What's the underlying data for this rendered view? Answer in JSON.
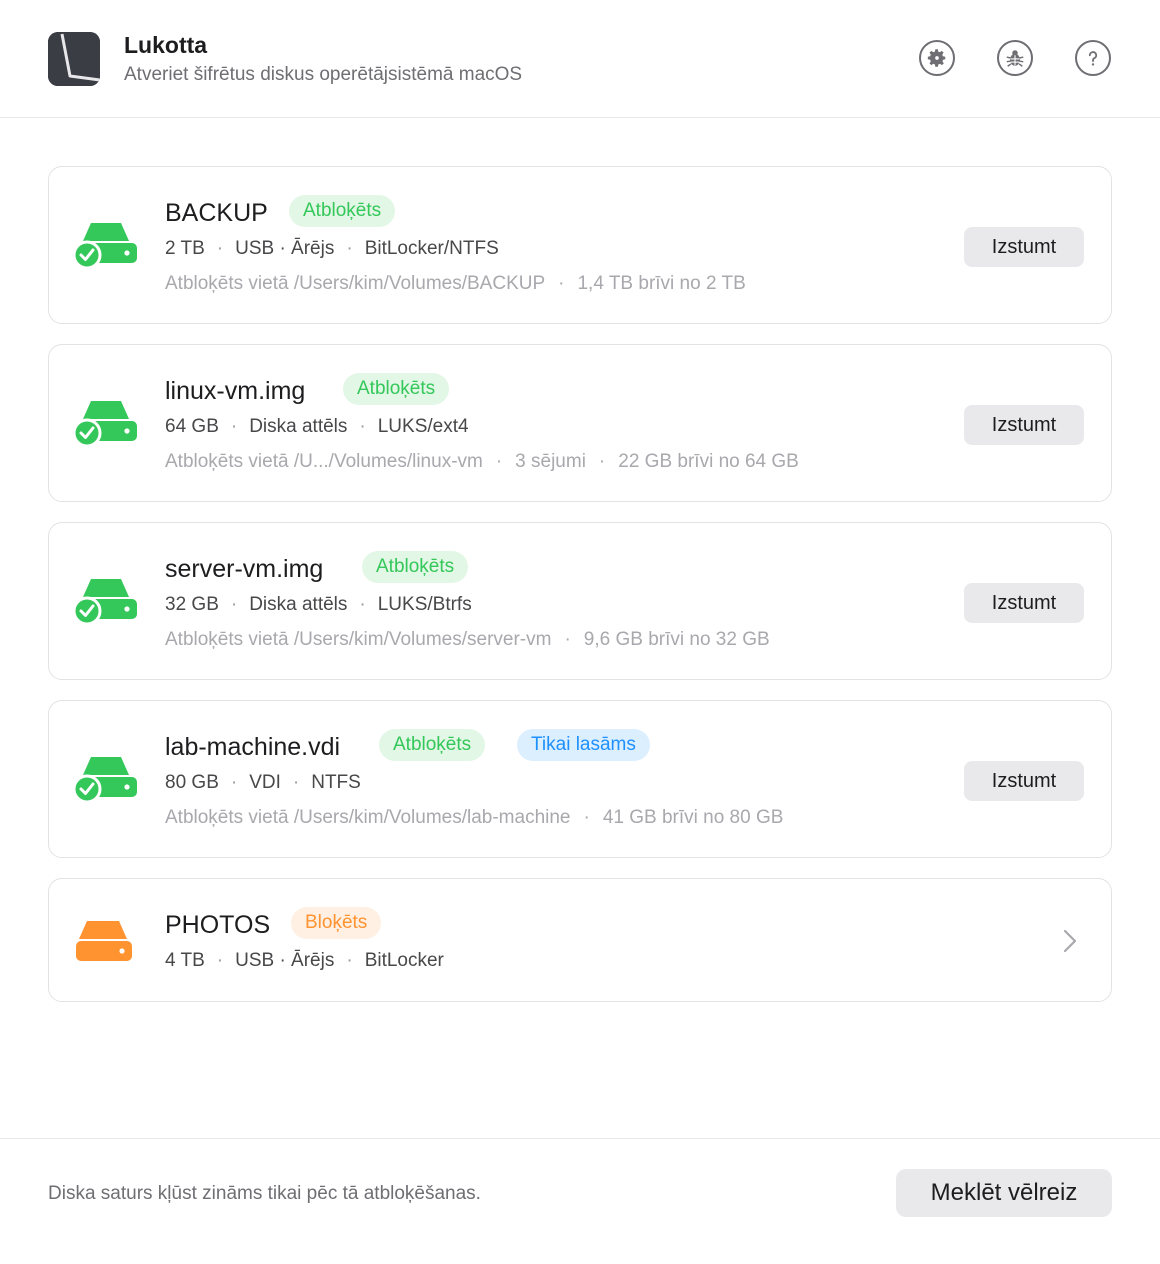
{
  "app": {
    "title": "Lukotta",
    "subtitle": "Atveriet šifrētus diskus operētājsistēmā macOS"
  },
  "header_buttons": [
    {
      "icon": "gear-icon"
    },
    {
      "icon": "bug-icon"
    },
    {
      "icon": "help-icon"
    }
  ],
  "colors": {
    "unlocked": "#34c759",
    "locked": "#ff9330",
    "readonly": "#1e90ff"
  },
  "disks": [
    {
      "name": "BACKUP",
      "status": "Atbloķēts",
      "size": "2 TB",
      "kind": "USB · Ārējs",
      "format": "BitLocker/NTFS",
      "path": "Atbloķēts vietā /Users/kim/Volumes/BACKUP",
      "free": "1,4 TB brīvi no 2 TB",
      "eject": "Izstumt"
    },
    {
      "name": "linux-vm.img",
      "status": "Atbloķēts",
      "size": "64 GB",
      "kind": "Diska attēls",
      "format": "LUKS/ext4",
      "path": "Atbloķēts vietā /U.../Volumes/linux-vm",
      "mounts": "3 sējumi",
      "free": "22 GB brīvi no 64 GB",
      "eject": "Izstumt"
    },
    {
      "name": "server-vm.img",
      "status": "Atbloķēts",
      "size": "32 GB",
      "kind": "Diska attēls",
      "format": "LUKS/Btrfs",
      "path": "Atbloķēts vietā /Users/kim/Volumes/server-vm",
      "free": "9,6 GB brīvi no 32 GB",
      "eject": "Izstumt"
    },
    {
      "name": "lab-machine.vdi",
      "status": "Atbloķēts",
      "extra_badge": "Tikai lasāms",
      "size": "80 GB",
      "kind": "VDI",
      "format": "NTFS",
      "path": "Atbloķēts vietā /Users/kim/Volumes/lab-machine",
      "free": "41 GB brīvi no 80 GB",
      "eject": "Izstumt"
    },
    {
      "name": "PHOTOS",
      "status": "Bloķēts",
      "size": "4 TB",
      "kind": "USB · Ārējs",
      "format": "BitLocker"
    }
  ],
  "footer": {
    "note": "Diska saturs kļūst zināms tikai pēc tā atbloķēšanas.",
    "rescan": "Meklēt vēlreiz"
  },
  "dot": "·"
}
